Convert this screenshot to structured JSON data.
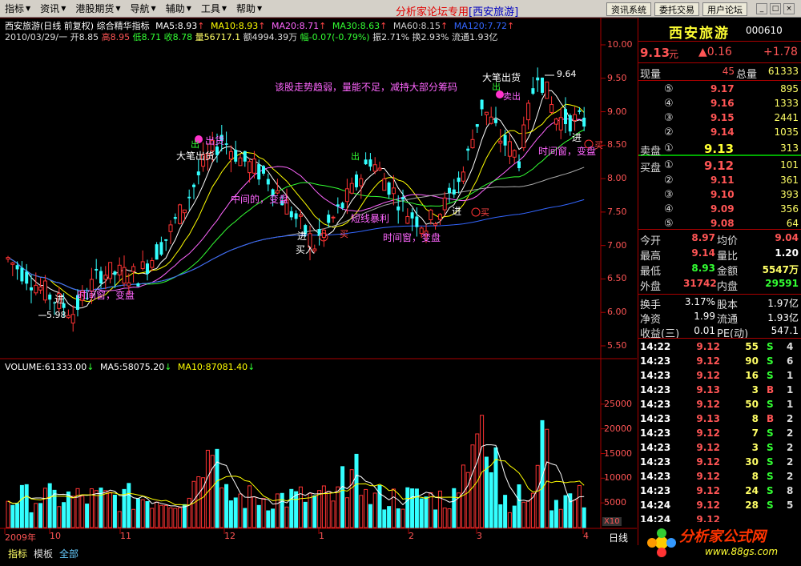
{
  "menubar": {
    "items": [
      "指标",
      "资讯",
      "港股期货",
      "导航",
      "辅助",
      "工具",
      "帮助"
    ],
    "title_prefix": "分析家论坛专用",
    "title_stock": "[西安旅游]",
    "buttons": [
      "资讯系统",
      "委托交易",
      "用户论坛"
    ],
    "window_controls": [
      "_",
      "□",
      "×"
    ]
  },
  "chart": {
    "header_line1_title": "西安旅游(日线 前复权) 综合精华指标",
    "ma": [
      {
        "label": "MA5:8.93",
        "color": "#ffffff"
      },
      {
        "label": "MA10:8.93",
        "color": "#ffff00"
      },
      {
        "label": "MA20:8.71",
        "color": "#ff66ff"
      },
      {
        "label": "MA30:8.63",
        "color": "#33ff33"
      },
      {
        "label": "MA60:8.15",
        "color": "#cccccc"
      },
      {
        "label": "MA120:7.72",
        "color": "#3366ff"
      }
    ],
    "header_line2": {
      "date": "2010/03/29/一",
      "open": "开8.85",
      "high": "高8.95",
      "low": "低8.71",
      "close": "收8.78",
      "vol": "量56717.1",
      "amount": "额4994.39万",
      "change": "幅-0.07(-0.79%)",
      "amplitude": "振2.71%",
      "turnover": "换2.93%",
      "float": "流通1.93亿"
    },
    "y_ticks": [
      "10.00",
      "9.50",
      "9.00",
      "8.50",
      "8.00",
      "7.50",
      "7.00",
      "6.50",
      "6.00",
      "5.50"
    ],
    "vol_y_ticks": [
      "25000",
      "20000",
      "15000",
      "10000",
      "5000"
    ],
    "vol_header": {
      "vol": "VOLUME:61333.00",
      "ma5": "MA5:58075.20",
      "ma10": "MA10:87081.40"
    },
    "vol_unit": "X10",
    "x_ticks": [
      "2009年",
      "10",
      "11",
      "12",
      "1",
      "2",
      "3",
      "4"
    ],
    "period": "日线",
    "high_mark": "9.64",
    "low_mark": "5.98",
    "notice": "该股走势趋弱，量能不足，减持大部分筹码",
    "annotations": [
      "出货",
      "大笔出货",
      "出",
      "中间的，变盘",
      "出",
      "短线暴利",
      "大笔出货",
      "出",
      "时间窗，变盘",
      "进",
      "买",
      "时间窗，变盘",
      "进",
      "买入",
      "时间窗，变盘",
      "进",
      "买",
      "进",
      "买",
      "卖出"
    ]
  },
  "chart_data": {
    "type": "candlestick",
    "x": [
      "2009-09",
      "2009-10",
      "2009-11",
      "2009-12",
      "2010-01",
      "2010-02",
      "2010-03",
      "2010-04"
    ],
    "ylim": [
      5.5,
      10.0
    ],
    "low_point": 5.98,
    "high_point": 9.64,
    "last": {
      "date": "2010-03-29",
      "open": 8.85,
      "high": 8.95,
      "low": 8.71,
      "close": 8.78,
      "volume": 56717.1
    },
    "ma_series": [
      {
        "name": "MA5",
        "value": 8.93
      },
      {
        "name": "MA10",
        "value": 8.93
      },
      {
        "name": "MA20",
        "value": 8.71
      },
      {
        "name": "MA30",
        "value": 8.63
      },
      {
        "name": "MA60",
        "value": 8.15
      },
      {
        "name": "MA120",
        "value": 7.72
      }
    ],
    "volume": {
      "last": 61333.0,
      "ma5": 58075.2,
      "ma10": 87081.4,
      "ylim": [
        0,
        30000
      ]
    }
  },
  "quote": {
    "name": "西安旅游",
    "code": "000610",
    "price": "9.13",
    "price_unit": "元",
    "change": "▲0.16",
    "change2": "+1.78",
    "now_label": "现量",
    "now_val": "45",
    "total_label": "总量",
    "total_val": "61333",
    "sells": [
      {
        "lvl": "⑤",
        "price": "9.17",
        "vol": "895"
      },
      {
        "lvl": "④",
        "price": "9.16",
        "vol": "1333"
      },
      {
        "lvl": "③",
        "price": "9.15",
        "vol": "2441"
      },
      {
        "lvl": "②",
        "price": "9.14",
        "vol": "1035"
      }
    ],
    "sell1": {
      "label": "卖盘",
      "lvl": "①",
      "price": "9.13",
      "vol": "313"
    },
    "buy1": {
      "label": "买盘",
      "lvl": "①",
      "price": "9.12",
      "vol": "101"
    },
    "buys": [
      {
        "lvl": "②",
        "price": "9.11",
        "vol": "361"
      },
      {
        "lvl": "③",
        "price": "9.10",
        "vol": "393"
      },
      {
        "lvl": "④",
        "price": "9.09",
        "vol": "356"
      },
      {
        "lvl": "⑤",
        "price": "9.08",
        "vol": "64"
      }
    ],
    "stats": [
      {
        "l1": "今开",
        "v1": "8.97",
        "c1": "#ff5555",
        "l2": "均价",
        "v2": "9.04",
        "c2": "#ff5555"
      },
      {
        "l1": "最高",
        "v1": "9.14",
        "c1": "#ff5555",
        "l2": "量比",
        "v2": "1.20",
        "c2": "#ffffff"
      },
      {
        "l1": "最低",
        "v1": "8.93",
        "c1": "#33ff33",
        "l2": "金额",
        "v2": "5547万",
        "c2": "#ffff66"
      },
      {
        "l1": "外盘",
        "v1": "31742",
        "c1": "#ff5555",
        "l2": "内盘",
        "v2": "29591",
        "c2": "#33ff33"
      }
    ],
    "stats2": [
      {
        "l1": "换手",
        "v1": "3.17%",
        "l2": "股本",
        "v2": "1.97亿"
      },
      {
        "l1": "净资",
        "v1": "1.99",
        "l2": "流通",
        "v2": "1.93亿"
      },
      {
        "l1": "收益(三)",
        "v1": "0.01",
        "l2": "PE(动)",
        "v2": "547.1"
      }
    ],
    "ticks": [
      {
        "t": "14:22",
        "p": "9.12",
        "v": "55",
        "s": "S",
        "n": "4"
      },
      {
        "t": "14:23",
        "p": "9.12",
        "v": "90",
        "s": "S",
        "n": "6"
      },
      {
        "t": "14:23",
        "p": "9.12",
        "v": "16",
        "s": "S",
        "n": "1"
      },
      {
        "t": "14:23",
        "p": "9.13",
        "v": "3",
        "s": "B",
        "n": "1"
      },
      {
        "t": "14:23",
        "p": "9.12",
        "v": "50",
        "s": "S",
        "n": "1"
      },
      {
        "t": "14:23",
        "p": "9.13",
        "v": "8",
        "s": "B",
        "n": "2"
      },
      {
        "t": "14:23",
        "p": "9.12",
        "v": "7",
        "s": "S",
        "n": "2"
      },
      {
        "t": "14:23",
        "p": "9.12",
        "v": "3",
        "s": "S",
        "n": "2"
      },
      {
        "t": "14:23",
        "p": "9.12",
        "v": "30",
        "s": "S",
        "n": "2"
      },
      {
        "t": "14:23",
        "p": "9.12",
        "v": "8",
        "s": "S",
        "n": "2"
      },
      {
        "t": "14:23",
        "p": "9.12",
        "v": "24",
        "s": "S",
        "n": "8"
      },
      {
        "t": "14:24",
        "p": "9.12",
        "v": "28",
        "s": "S",
        "n": "5"
      },
      {
        "t": "14:24",
        "p": "9.12",
        "v": "",
        "s": "",
        "n": ""
      }
    ]
  },
  "bottom": {
    "tabs": [
      "指标",
      "模板",
      "全部"
    ],
    "logo_text": "分析家公式网",
    "logo_url": "www.88gs.com"
  }
}
